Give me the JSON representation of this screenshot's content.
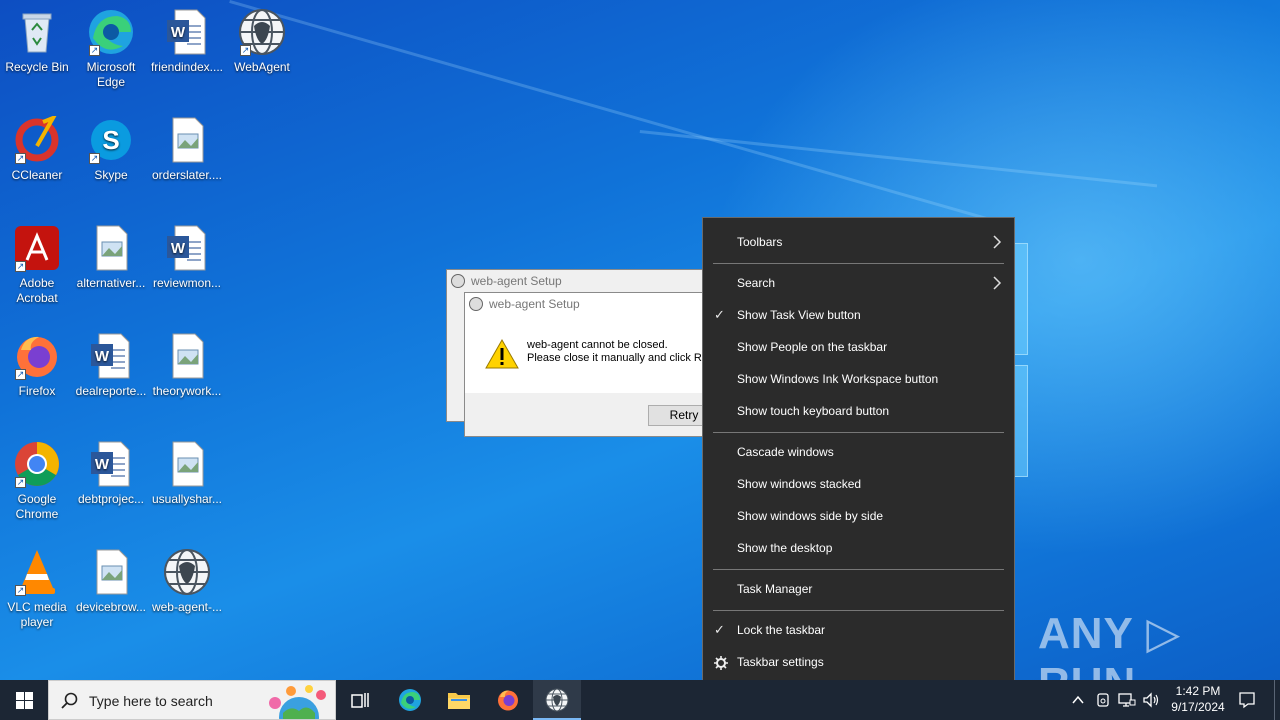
{
  "desktop_icons": [
    {
      "label": "Recycle Bin",
      "icon": "recycle-bin-icon"
    },
    {
      "label": "Microsoft Edge",
      "icon": "edge-icon"
    },
    {
      "label": "friendindex....",
      "icon": "word-doc-icon"
    },
    {
      "label": "WebAgent",
      "icon": "webagent-icon"
    },
    {
      "label": "CCleaner",
      "icon": "ccleaner-icon"
    },
    {
      "label": "Skype",
      "icon": "skype-icon"
    },
    {
      "label": "orderslater....",
      "icon": "image-file-icon"
    },
    {
      "label": "Adobe Acrobat",
      "icon": "acrobat-icon"
    },
    {
      "label": "alternativer...",
      "icon": "image-file-icon"
    },
    {
      "label": "reviewmon...",
      "icon": "word-doc-icon"
    },
    {
      "label": "Firefox",
      "icon": "firefox-icon"
    },
    {
      "label": "dealreporte...",
      "icon": "word-doc-icon"
    },
    {
      "label": "theorywork...",
      "icon": "image-file-icon"
    },
    {
      "label": "Google Chrome",
      "icon": "chrome-icon"
    },
    {
      "label": "debtprojec...",
      "icon": "word-doc-icon"
    },
    {
      "label": "usuallyshar...",
      "icon": "image-file-icon"
    },
    {
      "label": "VLC media player",
      "icon": "vlc-icon"
    },
    {
      "label": "devicebrow...",
      "icon": "image-file-icon"
    },
    {
      "label": "web-agent-...",
      "icon": "webagent-icon"
    }
  ],
  "dialog_back": {
    "title": "web-agent Setup"
  },
  "dialog_front": {
    "title": "web-agent Setup",
    "message_line1": "web-agent cannot be closed.",
    "message_line2": "Please close it manually and click R",
    "retry_label": "Retry"
  },
  "context_menu": {
    "toolbars": "Toolbars",
    "search": "Search",
    "show_task_view": "Show Task View button",
    "show_people": "Show People on the taskbar",
    "show_ink": "Show Windows Ink Workspace button",
    "show_touch_kb": "Show touch keyboard button",
    "cascade": "Cascade windows",
    "stacked": "Show windows stacked",
    "side_by_side": "Show windows side by side",
    "show_desktop": "Show the desktop",
    "task_manager": "Task Manager",
    "lock_taskbar": "Lock the taskbar",
    "taskbar_settings": "Taskbar settings",
    "check_glyph": "✓"
  },
  "taskbar": {
    "search_placeholder": "Type here to search",
    "time": "1:42 PM",
    "date": "9/17/2024"
  },
  "watermark": "ANY ▷ RUN",
  "colors": {
    "accent": "#0a6fd8",
    "menu_bg": "#2b2b2b",
    "taskbar_bg": "#1c2634"
  }
}
